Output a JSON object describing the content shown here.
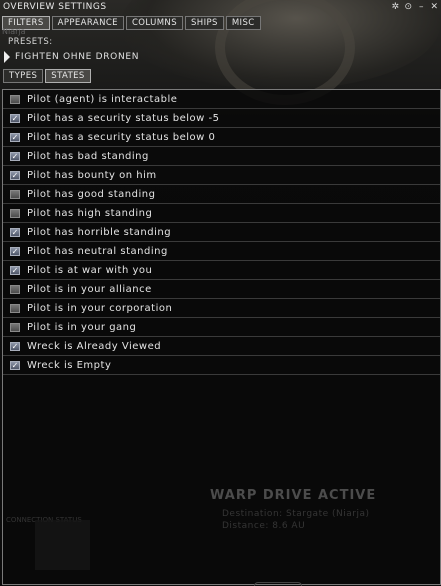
{
  "window": {
    "title": "OVERVIEW SETTINGS",
    "buttons": [
      {
        "name": "settings-icon",
        "glyph": "✲"
      },
      {
        "name": "target-icon",
        "glyph": "⊙"
      },
      {
        "name": "minimize-icon",
        "glyph": "–"
      },
      {
        "name": "close-icon",
        "glyph": "✕"
      }
    ]
  },
  "tabs": [
    "FILTERS",
    "APPEARANCE",
    "COLUMNS",
    "SHIPS",
    "MISC"
  ],
  "active_tab": "FILTERS",
  "ghost_label": "Niarja",
  "presets_label": "PRESETS:",
  "preset_name": "FIGHTEN OHNE DRONEN",
  "subtabs": [
    "TYPES",
    "STATES"
  ],
  "active_subtab": "STATES",
  "states": [
    {
      "label": "Pilot (agent) is interactable",
      "checked": false
    },
    {
      "label": "Pilot has a security status below -5",
      "checked": true
    },
    {
      "label": "Pilot has a security status below 0",
      "checked": true
    },
    {
      "label": "Pilot has bad standing",
      "checked": true
    },
    {
      "label": "Pilot has bounty on him",
      "checked": true
    },
    {
      "label": "Pilot has good standing",
      "checked": false
    },
    {
      "label": "Pilot has high standing",
      "checked": false
    },
    {
      "label": "Pilot has horrible standing",
      "checked": true
    },
    {
      "label": "Pilot has neutral standing",
      "checked": true
    },
    {
      "label": "Pilot is at war with you",
      "checked": true
    },
    {
      "label": "Pilot is in your alliance",
      "checked": false
    },
    {
      "label": "Pilot is in your corporation",
      "checked": false
    },
    {
      "label": "Pilot is in your gang",
      "checked": false
    },
    {
      "label": "Wreck is Already Viewed",
      "checked": true
    },
    {
      "label": "Wreck is Empty",
      "checked": true
    }
  ],
  "background_text": {
    "warp": "WARP DRIVE ACTIVE",
    "warp_line1": "Destination: Stargate (Niarja)",
    "warp_line2": "Distance: 8.6 AU",
    "corner": "CONNECTION STATUS"
  }
}
